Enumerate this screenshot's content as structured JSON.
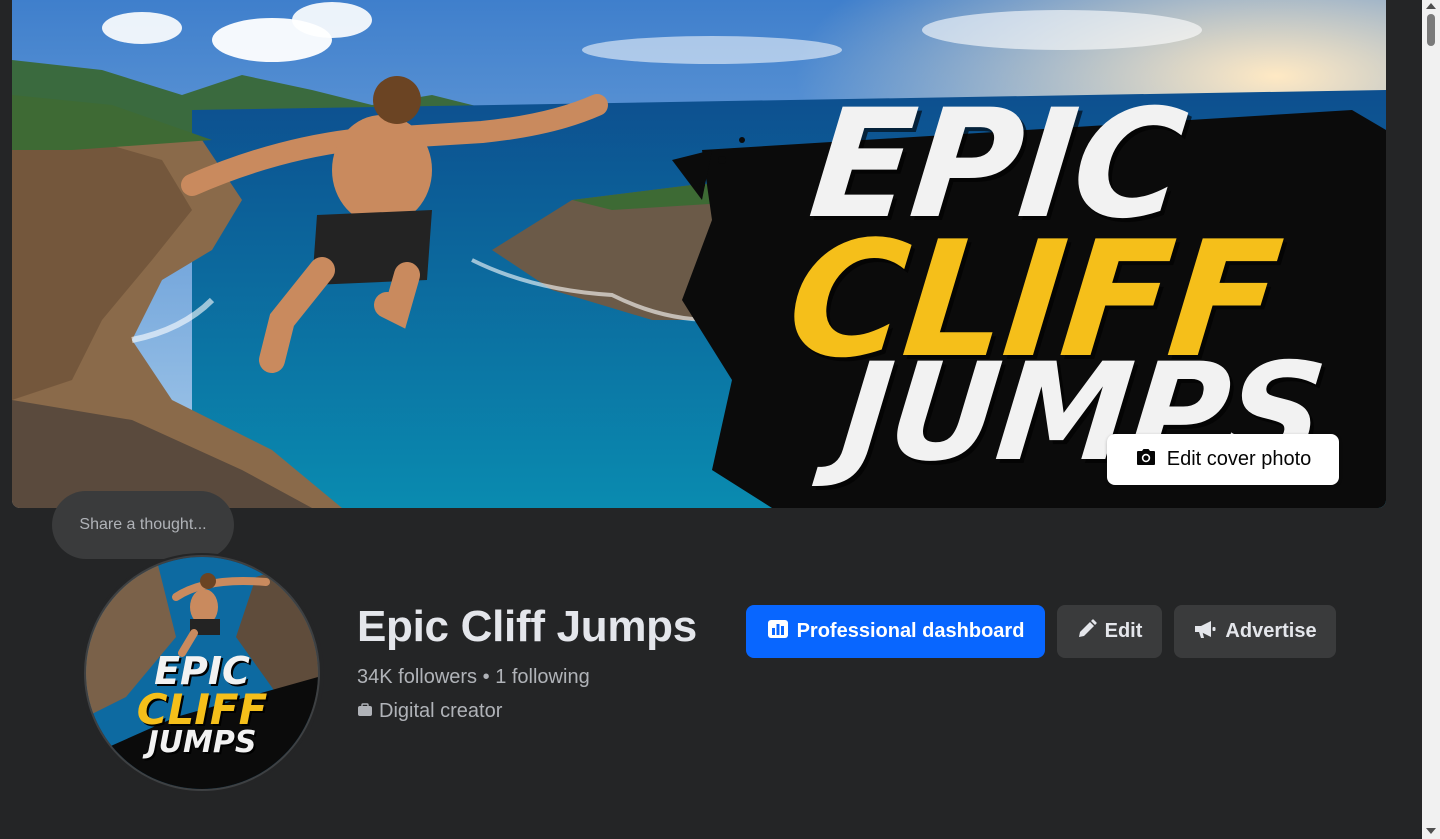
{
  "cover": {
    "title_line1": "EPIC",
    "title_line2": "CLIFF",
    "title_line3": "JUMPS",
    "edit_label": "Edit cover photo",
    "edit_icon": "camera-icon"
  },
  "composer": {
    "thought_placeholder": "Share a thought..."
  },
  "profile": {
    "avatar_line1": "EPIC",
    "avatar_line2": "CLIFF",
    "avatar_line3": "JUMPS",
    "name": "Epic Cliff Jumps",
    "followers": "34K followers",
    "separator": " • ",
    "following": "1 following",
    "category": "Digital creator",
    "category_icon": "briefcase-icon"
  },
  "actions": {
    "dashboard_label": "Professional dashboard",
    "dashboard_icon": "bar-chart-icon",
    "edit_label": "Edit",
    "edit_icon": "pencil-icon",
    "advertise_label": "Advertise",
    "advertise_icon": "megaphone-icon"
  },
  "colors": {
    "background": "#242526",
    "primary_button": "#0866ff",
    "secondary_button": "#3a3b3c",
    "text_primary": "#e4e6eb",
    "text_secondary": "#b0b3b8",
    "accent_yellow": "#f5bf1a"
  }
}
